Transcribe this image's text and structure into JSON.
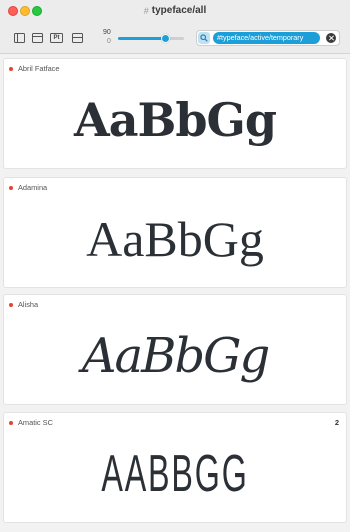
{
  "window": {
    "title_prefix": "#",
    "title": "typeface/all"
  },
  "toolbar": {
    "icons": [
      "sidebar-left-icon",
      "panel-top-icon",
      "preview-icon",
      "split-horizontal-icon"
    ],
    "preview_icon_text": "Pt",
    "size_value": "90",
    "size_min": "0",
    "slider_fraction": 0.72
  },
  "search": {
    "token": "#typeface/active/temporary"
  },
  "fonts": [
    {
      "name": "Abril Fatface",
      "sample": "AaBbGg",
      "count": ""
    },
    {
      "name": "Adamina",
      "sample": "AaBbGg",
      "count": ""
    },
    {
      "name": "Alisha",
      "sample": "AaBbGg",
      "count": ""
    },
    {
      "name": "Amatic SC",
      "sample": "AABBGG",
      "count": "2"
    }
  ],
  "colors": {
    "accent": "#1c9fd8",
    "status_dot": "#e8432e"
  }
}
